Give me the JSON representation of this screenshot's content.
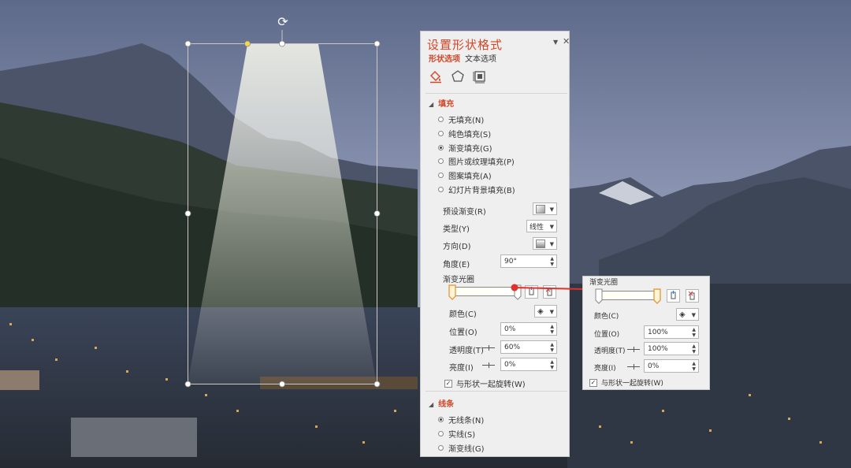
{
  "pane": {
    "title": "设置形状格式",
    "tabs": [
      "形状选项",
      "文本选项"
    ],
    "fill_section": "填充",
    "fill_options": [
      {
        "label": "无填充(N)",
        "selected": false
      },
      {
        "label": "纯色填充(S)",
        "selected": false
      },
      {
        "label": "渐变填充(G)",
        "selected": true
      },
      {
        "label": "图片或纹理填充(P)",
        "selected": false
      },
      {
        "label": "图案填充(A)",
        "selected": false
      },
      {
        "label": "幻灯片背景填充(B)",
        "selected": false
      }
    ],
    "preset_label": "预设渐变(R)",
    "type_label": "类型(Y)",
    "type_value": "线性",
    "direction_label": "方向(D)",
    "angle_label": "角度(E)",
    "angle_value": "90°",
    "stops_label": "渐变光圈",
    "color_label": "颜色(C)",
    "position_label": "位置(O)",
    "position_value": "0%",
    "transparency_label": "透明度(T)",
    "transparency_value": "60%",
    "brightness_label": "亮度(I)",
    "brightness_value": "0%",
    "rotate_label": "与形状一起旋转(W)",
    "line_section": "线条",
    "line_options": [
      {
        "label": "无线条(N)",
        "selected": true
      },
      {
        "label": "实线(S)",
        "selected": false
      },
      {
        "label": "渐变线(G)",
        "selected": false
      }
    ]
  },
  "zoom": {
    "stops_label": "渐变光圈",
    "color_label": "颜色(C)",
    "position_label": "位置(O)",
    "position_value": "100%",
    "transparency_label": "透明度(T)",
    "transparency_value": "100%",
    "brightness_label": "亮度(I)",
    "brightness_value": "0%",
    "rotate_label": "与形状一起旋转(W)"
  },
  "colors": {
    "accent": "#d24726",
    "arrow": "#e03030"
  },
  "icons": [
    "rotate-handle-icon",
    "fill-line-icon",
    "effects-icon",
    "size-properties-icon",
    "close-icon",
    "menu-caret-icon",
    "add-stop-icon",
    "remove-stop-icon",
    "paint-bucket-icon"
  ]
}
